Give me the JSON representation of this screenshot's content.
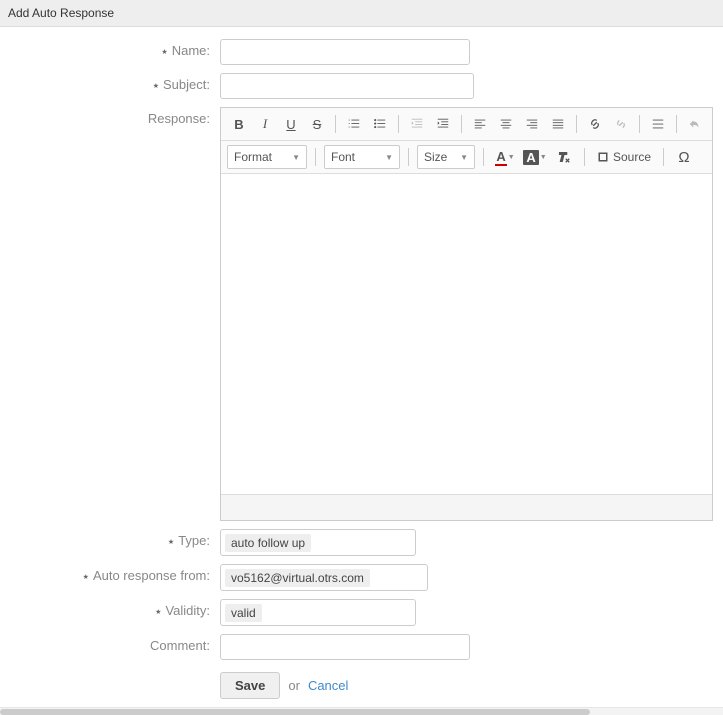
{
  "header": {
    "title": "Add Auto Response"
  },
  "labels": {
    "name": "Name:",
    "subject": "Subject:",
    "response": "Response:",
    "type": "Type:",
    "auto_response_from": "Auto response from:",
    "validity": "Validity:",
    "comment": "Comment:"
  },
  "editor": {
    "format_label": "Format",
    "font_label": "Font",
    "size_label": "Size",
    "source_label": "Source"
  },
  "fields": {
    "name_value": "",
    "subject_value": "",
    "comment_value": "",
    "type_value": "auto follow up",
    "from_value": "vo5162@virtual.otrs.com",
    "validity_value": "valid"
  },
  "actions": {
    "save": "Save",
    "or": "or",
    "cancel": "Cancel"
  }
}
